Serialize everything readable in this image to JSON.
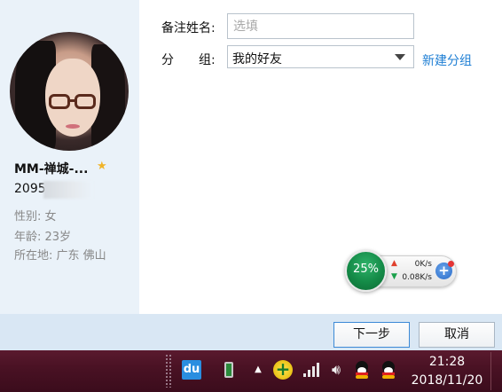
{
  "profile": {
    "nickname": "MM-禅城-...",
    "qq_number_visible": "2095",
    "gender": "性别: 女",
    "age": "年龄: 23岁",
    "location": "所在地: 广东  佛山"
  },
  "form": {
    "remark_label": "备注姓名:",
    "remark_placeholder": "选填",
    "remark_value": "",
    "group_label": "分　　组:",
    "group_value": "我的好友",
    "new_group_link": "新建分组"
  },
  "speed_widget": {
    "percent": "25%",
    "upload": "0K/s",
    "download": "0.08K/s"
  },
  "buttons": {
    "next": "下一步",
    "cancel": "取消"
  },
  "taskbar": {
    "baidu_icon_text": "du",
    "time": "21:28",
    "date": "2018/11/20"
  },
  "colors": {
    "panel_bg": "#eaf2f9",
    "link": "#1f7fd4",
    "taskbar": "#4a1224"
  }
}
